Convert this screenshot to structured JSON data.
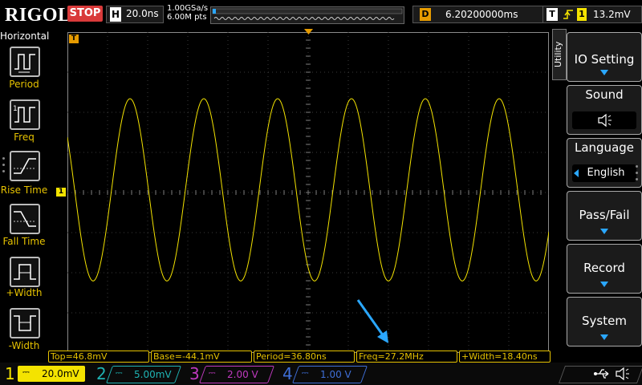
{
  "header": {
    "brand": "RIGOL",
    "run_state": "STOP",
    "horizontal_letter": "H",
    "timebase": "20.0ns",
    "sample_rate": "1.00GSa/s",
    "memory_depth": "6.00M pts",
    "delay_letter": "D",
    "delay": "6.20200000ms",
    "trigger_letter": "T",
    "trigger_source": "1",
    "trigger_level": "13.2mV"
  },
  "left_panel": {
    "title": "Horizontal",
    "items": [
      {
        "label": "Period",
        "icon": "period-icon"
      },
      {
        "label": "Freq",
        "icon": "freq-icon"
      },
      {
        "label": "Rise Time",
        "icon": "rise-time-icon"
      },
      {
        "label": "Fall Time",
        "icon": "fall-time-icon"
      },
      {
        "label": "+Width",
        "icon": "plus-width-icon"
      },
      {
        "label": "-Width",
        "icon": "minus-width-icon"
      }
    ]
  },
  "right_panel": {
    "tab_label": "Utility",
    "items": [
      {
        "label": "IO Setting"
      },
      {
        "label": "Sound",
        "icon": "speaker-icon"
      },
      {
        "label": "Language",
        "value": "English"
      },
      {
        "label": "Pass/Fail"
      },
      {
        "label": "Record"
      },
      {
        "label": "System"
      }
    ]
  },
  "measurements": [
    "Top=46.8mV",
    "Base=-44.1mV",
    "Period=36.80ns",
    "Freq=27.2MHz",
    "+Width=18.40ns"
  ],
  "channels": [
    {
      "num": "1",
      "scale": "20.0mV",
      "color": "#f4e300",
      "active": true
    },
    {
      "num": "2",
      "scale": "5.00mV",
      "color": "#1fb3b3",
      "active": false
    },
    {
      "num": "3",
      "scale": "2.00 V",
      "color": "#c03ac0",
      "active": false
    },
    {
      "num": "4",
      "scale": "1.00 V",
      "color": "#3f6fd8",
      "active": false
    }
  ],
  "markers": {
    "trigger_pos": "T",
    "channel1_ref": "1"
  },
  "colors": {
    "trace": "#f4e300",
    "accent": "#2aa7ff",
    "marker": "#e69b00"
  }
}
